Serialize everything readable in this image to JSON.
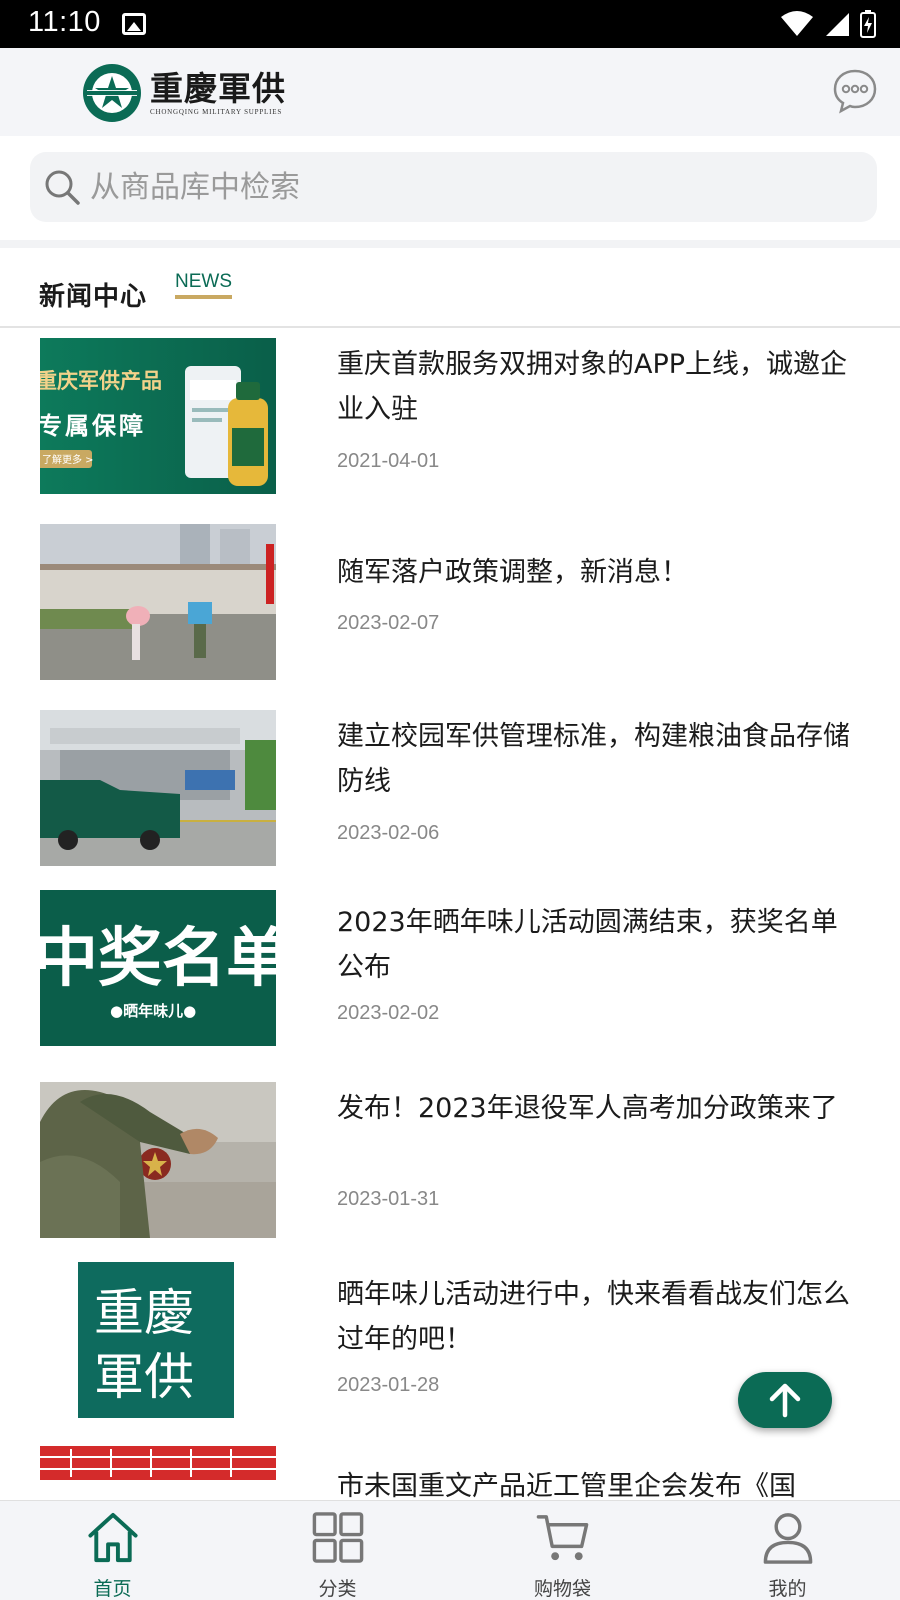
{
  "status_bar": {
    "time": "11:10"
  },
  "header": {
    "logo_title": "重慶軍供",
    "logo_subtitle": "CHONGQING MILITARY SUPPLIES"
  },
  "search": {
    "placeholder": "从商品库中检索"
  },
  "news_section": {
    "title": "新闻中心",
    "title_en": "NEWS"
  },
  "news": [
    {
      "title": "重庆首款服务双拥对象的APP上线，诚邀企业入驻",
      "date": "2021-04-01",
      "thumb_text": [
        "重庆军供产品",
        "专属保障",
        "了解更多 >"
      ]
    },
    {
      "title": "随军落户政策调整，新消息！",
      "date": "2023-02-07"
    },
    {
      "title": "建立校园军供管理标准，构建粮油食品存储防线",
      "date": "2023-02-06"
    },
    {
      "title": "2023年晒年味儿活动圆满结束，获奖名单公布",
      "date": "2023-02-02",
      "thumb_text": [
        "中奖名单",
        "●晒年味儿●"
      ]
    },
    {
      "title": "发布！2023年退役军人高考加分政策来了",
      "date": "2023-01-31"
    },
    {
      "title": "晒年味儿活动进行中，快来看看战友们怎么过年的吧！",
      "date": "2023-01-28",
      "thumb_text": [
        "重慶",
        "軍供"
      ]
    },
    {
      "title": "市未国重文产品近工管里企会发布《国",
      "date": ""
    }
  ],
  "bottom_nav": [
    {
      "label": "首页",
      "icon": "home-icon",
      "active": true
    },
    {
      "label": "分类",
      "icon": "grid-icon",
      "active": false
    },
    {
      "label": "购物袋",
      "icon": "cart-icon",
      "active": false
    },
    {
      "label": "我的",
      "icon": "person-icon",
      "active": false
    }
  ],
  "colors": {
    "brand": "#0b6b55",
    "accent_gold": "#c9a962"
  }
}
